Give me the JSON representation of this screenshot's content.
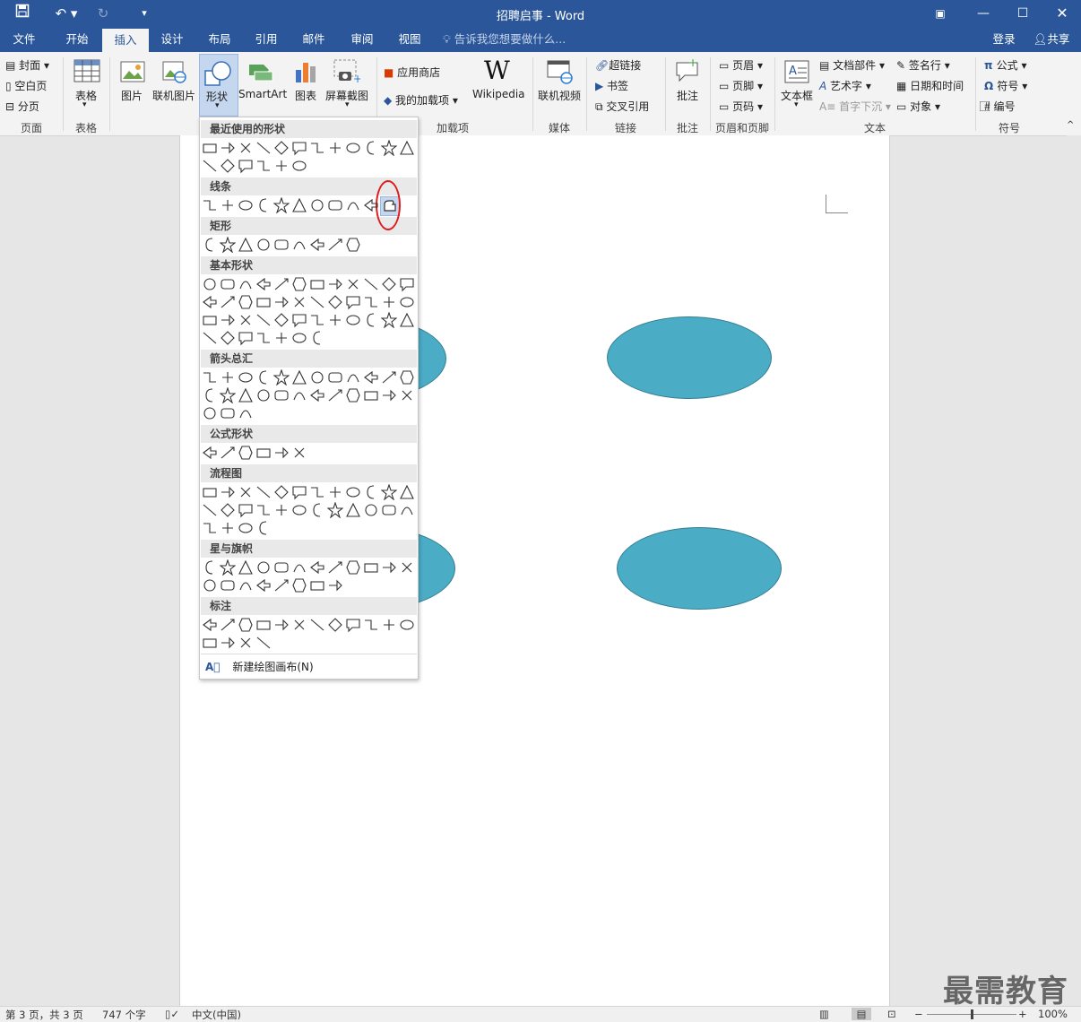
{
  "window": {
    "title": "招聘启事 - Word",
    "min_icon": "minimize-icon",
    "max_icon": "maximize-icon",
    "close_icon": "close-icon"
  },
  "tabs": [
    "文件",
    "开始",
    "插入",
    "设计",
    "布局",
    "引用",
    "邮件",
    "审阅",
    "视图"
  ],
  "active_tab": "插入",
  "tell_me": "告诉我您想要做什么...",
  "login": "登录",
  "share": "共享",
  "ribbon": {
    "pages": {
      "cover": "封面",
      "blank": "空白页",
      "break": "分页",
      "label": "页面"
    },
    "tables": {
      "table": "表格",
      "label": "表格"
    },
    "illustrations": {
      "picture": "图片",
      "online_picture": "联机图片",
      "shapes": "形状",
      "smartart": "SmartArt",
      "chart": "图表",
      "screenshot": "屏幕截图"
    },
    "addins": {
      "store": "应用商店",
      "my_addins": "我的加载项",
      "wikipedia": "Wikipedia",
      "label": "加载项"
    },
    "media": {
      "online_video": "联机视频",
      "label": "媒体"
    },
    "links": {
      "hyperlink": "超链接",
      "bookmark": "书签",
      "crossref": "交叉引用",
      "label": "链接"
    },
    "comments": {
      "comment": "批注",
      "label": "批注"
    },
    "header_footer": {
      "header": "页眉",
      "footer": "页脚",
      "page_number": "页码",
      "label": "页眉和页脚"
    },
    "text": {
      "textbox": "文本框",
      "quickparts": "文档部件",
      "wordart": "艺术字",
      "dropcap": "首字下沉",
      "signature": "签名行",
      "datetime": "日期和时间",
      "object": "对象",
      "label": "文本"
    },
    "symbols": {
      "equation": "公式",
      "symbol": "符号",
      "number": "编号",
      "label": "符号"
    }
  },
  "dropdown": {
    "sections": [
      "最近使用的形状",
      "线条",
      "矩形",
      "基本形状",
      "箭头总汇",
      "公式形状",
      "流程图",
      "星与旗帜",
      "标注"
    ],
    "new_canvas": "新建绘图画布(N)"
  },
  "status": {
    "page": "第 3 页，共 3 页",
    "words": "747 个字",
    "language": "中文(中国)",
    "zoom": "100%",
    "zoom_level": 0.5
  },
  "watermark": "最需教育",
  "colors": {
    "accent": "#2b579a",
    "ellipse": "#4bacc6",
    "highlight": "#e01b1b"
  }
}
